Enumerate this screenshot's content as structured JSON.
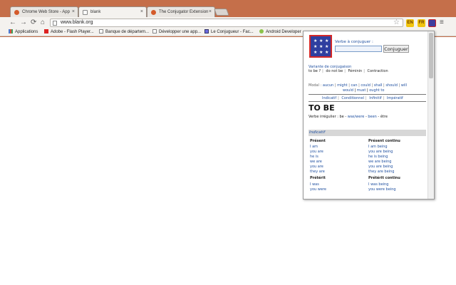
{
  "browser": {
    "tabs": [
      {
        "title": "Chrome Web Store - App"
      },
      {
        "title": "blank"
      },
      {
        "title": "The Conjugator Extension"
      }
    ],
    "url": "www.blank.org",
    "bookmarks": [
      {
        "label": "Applications",
        "icon": "apps-icon"
      },
      {
        "label": "Adobe - Flash Player...",
        "icon": "adobe-icon"
      },
      {
        "label": "Banque de départem...",
        "icon": "page-icon"
      },
      {
        "label": "Développer une app...",
        "icon": "page-icon"
      },
      {
        "label": "Le Conjugueur - Fac...",
        "icon": "conjugueur-icon"
      },
      {
        "label": "Android Developer",
        "icon": "android-icon"
      }
    ],
    "extensions": [
      "EN",
      "FR"
    ]
  },
  "popup": {
    "verbe_label": "Verbe à conjuguer :",
    "input_value": "",
    "button_label": "Conjuguer",
    "variante_label": "Variante de conjugaison",
    "variante_items": [
      "to be ?",
      "do not be",
      "Féminin",
      "Contraction"
    ],
    "modal_label": "Modal :",
    "modal_items": [
      "aucun",
      "might",
      "can",
      "could",
      "shall",
      "should",
      "will",
      "would",
      "must",
      "ought to"
    ],
    "mode_tabs": [
      "Indicatif",
      "Conditionnel",
      "Infinitif",
      "Impératif"
    ],
    "verb_title": "TO BE",
    "irregular_prefix": "Verbe irrégulier : be - ",
    "irregular_forms": "was/were",
    "irregular_sep": " - ",
    "irregular_pp": "been",
    "irregular_suffix": " - être",
    "mode_header": "Indicatif",
    "tenses": [
      {
        "title": "Présent",
        "lines": [
          "I am",
          "you are",
          "he is",
          "we are",
          "you are",
          "they are"
        ]
      },
      {
        "title": "Présent continu",
        "lines": [
          "I am being",
          "you are being",
          "he is being",
          "we are being",
          "you are being",
          "they are being"
        ]
      },
      {
        "title": "Prétérit",
        "lines": [
          "I was",
          "you were"
        ]
      },
      {
        "title": "Prétérit continu",
        "lines": [
          "I was being",
          "you were being"
        ]
      }
    ]
  }
}
